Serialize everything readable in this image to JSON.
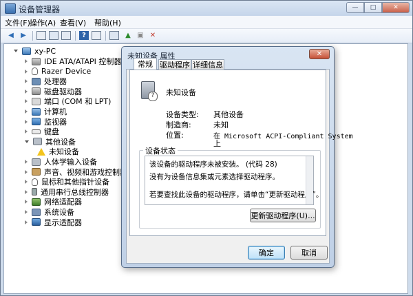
{
  "window": {
    "title": "设备管理器",
    "min_label": "—",
    "max_label": "□",
    "close_label": "✕"
  },
  "menu": [
    "文件(F)",
    "操作(A)",
    "查看(V)",
    "帮助(H)"
  ],
  "toolbar": {
    "icons": [
      "back-icon",
      "forward-icon",
      "properties-icon",
      "refresh-icon",
      "help-icon",
      "device-icon",
      "scan-icon",
      "update-driver-icon",
      "disable-icon",
      "uninstall-icon"
    ]
  },
  "tree": {
    "root": "xy-PC",
    "items": [
      {
        "label": "IDE ATA/ATAPI 控制器",
        "icon": "ic-disk"
      },
      {
        "label": "Razer Device",
        "icon": "ic-mouse"
      },
      {
        "label": "处理器",
        "icon": "ic-cpu"
      },
      {
        "label": "磁盘驱动器",
        "icon": "ic-disk"
      },
      {
        "label": "端口 (COM 和 LPT)",
        "icon": "ic-port"
      },
      {
        "label": "计算机",
        "icon": "ic-computer"
      },
      {
        "label": "监视器",
        "icon": "ic-monitor"
      },
      {
        "label": "键盘",
        "icon": "ic-keyboard"
      },
      {
        "label": "其他设备",
        "icon": "ic-unknown"
      },
      {
        "label": "未知设备",
        "icon": "ic-warn"
      },
      {
        "label": "人体学输入设备",
        "icon": "ic-unknown"
      },
      {
        "label": "声音、视频和游戏控制器",
        "icon": "ic-sound"
      },
      {
        "label": "鼠标和其他指针设备",
        "icon": "ic-mouse"
      },
      {
        "label": "通用串行总线控制器",
        "icon": "ic-usb"
      },
      {
        "label": "网络适配器",
        "icon": "ic-net"
      },
      {
        "label": "系统设备",
        "icon": "ic-sys"
      },
      {
        "label": "显示适配器",
        "icon": "ic-display"
      }
    ]
  },
  "dialog": {
    "title": "未知设备 属性",
    "close_label": "✕",
    "tabs": [
      "常规",
      "驱动程序",
      "详细信息"
    ],
    "device_name": "未知设备",
    "props": [
      {
        "label": "设备类型:",
        "value": "其他设备"
      },
      {
        "label": "制造商:",
        "value": "未知"
      },
      {
        "label": "位置:",
        "value": "在 Microsoft ACPI-Compliant System",
        "value2": "上"
      }
    ],
    "status_legend": "设备状态",
    "status_lines": [
      "该设备的驱动程序未被安装。 (代码 28)",
      "没有为设备信息集或元素选择驱动程序。",
      "若要查找此设备的驱动程序，请单击“更新驱动程序”。"
    ],
    "update_button": "更新驱动程序(U)...",
    "ok_button": "确定",
    "cancel_button": "取消"
  }
}
